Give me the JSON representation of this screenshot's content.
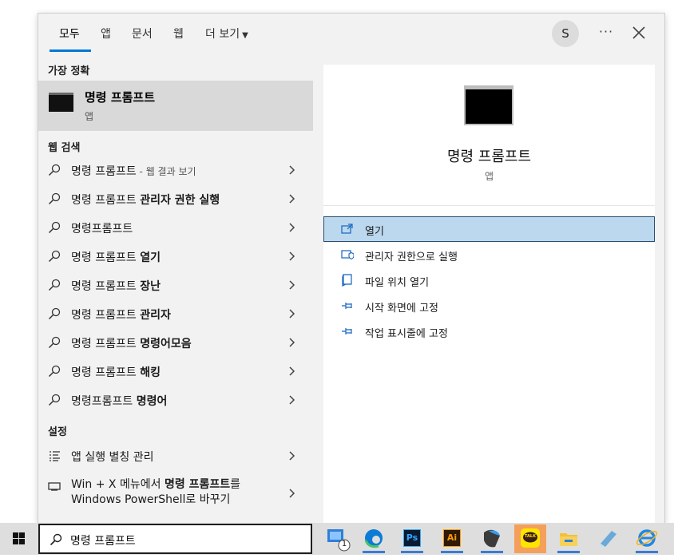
{
  "tabs": [
    "모두",
    "앱",
    "문서",
    "웹",
    "더 보기"
  ],
  "user_initial": "S",
  "more_label": "···",
  "sections": {
    "best_match": "가장 정확",
    "web_search": "웹 검색",
    "settings": "설정"
  },
  "best_match": {
    "title": "명령 프롬프트",
    "type": "앱"
  },
  "web_results": [
    {
      "plain": "명령 프롬프트",
      "bold": "",
      "suffix": " - 웹 결과 보기"
    },
    {
      "plain": "명령 프롬프트 ",
      "bold": "관리자 권한 실행",
      "suffix": ""
    },
    {
      "plain": "명령프롬프트",
      "bold": "",
      "suffix": ""
    },
    {
      "plain": "명령 프롬프트 ",
      "bold": "열기",
      "suffix": ""
    },
    {
      "plain": "명령 프롬프트 ",
      "bold": "장난",
      "suffix": ""
    },
    {
      "plain": "명령 프롬프트 ",
      "bold": "관리자",
      "suffix": ""
    },
    {
      "plain": "명령 프롬프트 ",
      "bold": "명령어모음",
      "suffix": ""
    },
    {
      "plain": "명령 프롬프트 ",
      "bold": "해킹",
      "suffix": ""
    },
    {
      "plain": "명령프롬프트 ",
      "bold": "명령어",
      "suffix": ""
    }
  ],
  "settings_results": {
    "item1": "앱 실행 별칭 관리",
    "item2_pre": "Win + X 메뉴에서 ",
    "item2_bold": "명령 프롬프트",
    "item2_post": "를",
    "item2_line2": "Windows PowerShell로 바꾸기"
  },
  "preview": {
    "title": "명령 프롬프트",
    "type": "앱"
  },
  "actions": [
    {
      "label": "열기",
      "icon": "open-icon"
    },
    {
      "label": "관리자 권한으로 실행",
      "icon": "shield-icon"
    },
    {
      "label": "파일 위치 열기",
      "icon": "folder-location-icon"
    },
    {
      "label": "시작 화면에 고정",
      "icon": "pin-icon"
    },
    {
      "label": "작업 표시줄에 고정",
      "icon": "pin-icon"
    }
  ],
  "taskbar": {
    "search_text": "명령 프롬프트",
    "badge": "1",
    "apps": [
      "app-badge-icon",
      "edge-icon",
      "photoshop-icon",
      "illustrator-icon",
      "vscode-icon",
      "kakaotalk-icon",
      "file-explorer-icon",
      "notepad-icon",
      "internet-explorer-icon"
    ],
    "ps_label": "Ps",
    "ai_label": "Ai",
    "talk_label": "TALK"
  },
  "colors": {
    "accent": "#0078d7",
    "selected_bg": "#bcd8ef",
    "kakao": "#fee500"
  }
}
